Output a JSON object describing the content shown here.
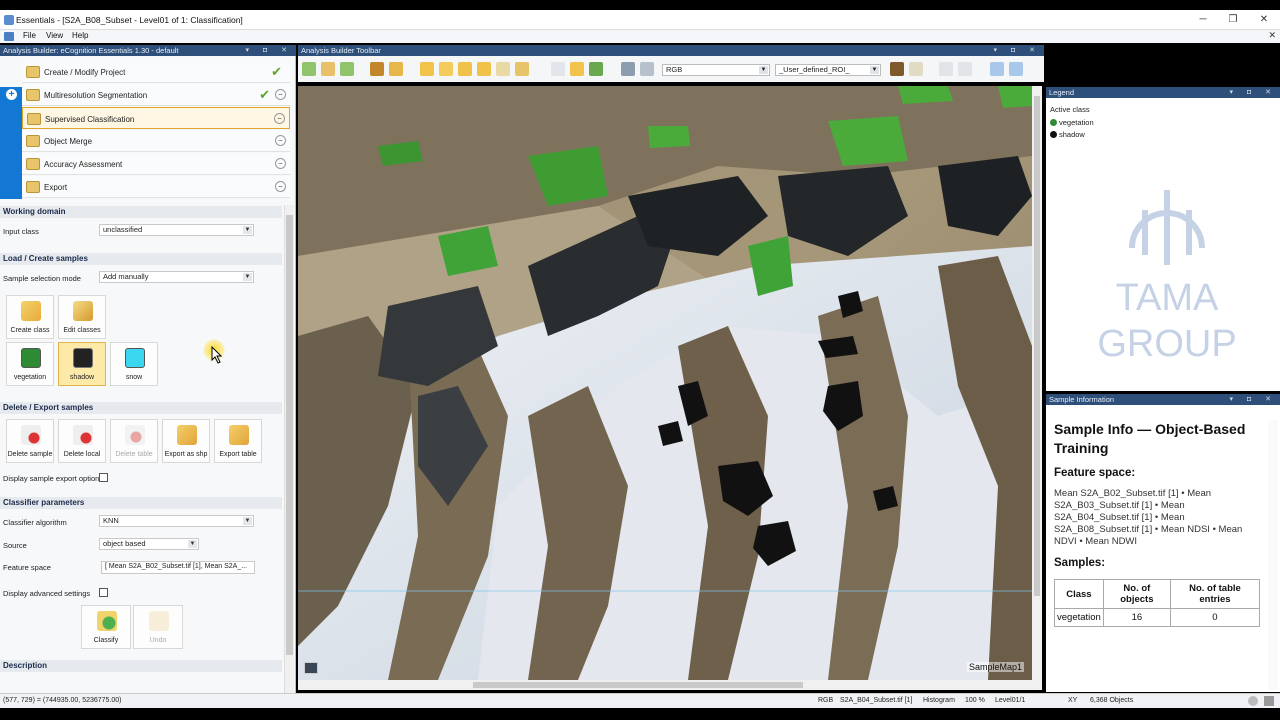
{
  "window": {
    "title": "Essentials - [S2A_B08_Subset - Level01 of 1: Classification]",
    "minimize": "─",
    "maximize": "❐",
    "close": "✕"
  },
  "menu": {
    "items": [
      "File",
      "View",
      "Help"
    ],
    "close": "✕"
  },
  "analysis_builder": {
    "header": "Analysis Builder: eCognition Essentials 1.30 - default",
    "steps": [
      {
        "label": "Create / Modify Project",
        "check": "✔"
      },
      {
        "label": "Multiresolution Segmentation",
        "check": "✔"
      },
      {
        "label": "Supervised Classification"
      },
      {
        "label": "Object Merge"
      },
      {
        "label": "Accuracy Assessment"
      },
      {
        "label": "Export"
      }
    ],
    "working_domain": {
      "title": "Working domain",
      "input_class_label": "Input class",
      "input_class_value": "unclassified"
    },
    "load_create": {
      "title": "Load / Create samples",
      "mode_label": "Sample selection mode",
      "mode_value": "Add manually",
      "buttons": [
        "Create class",
        "Edit classes"
      ],
      "classes": [
        {
          "label": "vegetation",
          "color": "#2e8b34"
        },
        {
          "label": "shadow",
          "color": "#222222"
        },
        {
          "label": "snow",
          "color": "#3bd6f0"
        }
      ]
    },
    "delete_export": {
      "title": "Delete / Export samples",
      "buttons": [
        "Delete sample",
        "Delete local",
        "Delete table",
        "Export as shp",
        "Export table"
      ],
      "display_options_label": "Display sample export options"
    },
    "classifier": {
      "title": "Classifier parameters",
      "algorithm_label": "Classifier algorithm",
      "algorithm_value": "KNN",
      "source_label": "Source",
      "source_value": "object based",
      "feature_label": "Feature space",
      "feature_value": "[ Mean S2A_B02_Subset.tif [1], Mean S2A_...",
      "advanced_label": "Display advanced settings",
      "classify": "Classify",
      "undo": "Undo"
    },
    "description": "Description"
  },
  "toolbar": {
    "header": "Analysis Builder Toolbar",
    "mode_select": "RGB",
    "roi_select": "_User_defined_ROI_"
  },
  "map": {
    "label": "SampleMap1"
  },
  "legend": {
    "header": "Legend",
    "active_class": "Active class",
    "items": [
      {
        "label": "vegetation",
        "color": "#2e8b34"
      },
      {
        "label": "shadow",
        "color": "#111111"
      }
    ],
    "watermark_line1": "TAMA",
    "watermark_line2": "GROUP"
  },
  "sample_info": {
    "header": "Sample Information",
    "title": "Sample Info — Object-Based Training",
    "feature_heading": "Feature space:",
    "feature_text": "Mean S2A_B02_Subset.tif [1] • Mean S2A_B03_Subset.tif [1] • Mean S2A_B04_Subset.tif [1] • Mean S2A_B08_Subset.tif [1] • Mean NDSI • Mean NDVI • Mean NDWI",
    "samples_heading": "Samples:",
    "table_headers": [
      "Class",
      "No. of objects",
      "No. of table entries"
    ],
    "rows": [
      {
        "class": "vegetation",
        "objects": "16",
        "entries": "0"
      }
    ]
  },
  "status": {
    "coords": "(577, 729) = (744935.00, 5236775.00)",
    "mode": "RGB",
    "layer": "S2A_B04_Subset.tif [1]",
    "histogram": "Histogram",
    "zoom": "100 %",
    "level": "Level01/1",
    "xy": "XY",
    "objects": "6,368 Objects"
  },
  "colors": {
    "panel_header": "#2e4f7a",
    "accent_blue": "#1378d4",
    "active_step": "#e0a32a",
    "check_green": "#5da52c"
  }
}
